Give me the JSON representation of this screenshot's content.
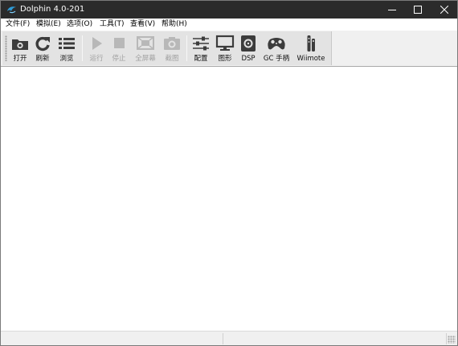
{
  "window": {
    "title": "Dolphin 4.0-201",
    "app_icon": "dolphin-icon",
    "controls": [
      "minimize-icon",
      "maximize-icon",
      "close-icon"
    ]
  },
  "menu": {
    "items": [
      {
        "label": "文件(F)"
      },
      {
        "label": "模拟(E)"
      },
      {
        "label": "选项(O)"
      },
      {
        "label": "工具(T)"
      },
      {
        "label": "查看(V)"
      },
      {
        "label": "帮助(H)"
      }
    ]
  },
  "toolbar": {
    "buttons": [
      {
        "label": "打开",
        "icon": "open-folder-icon",
        "enabled": true
      },
      {
        "label": "刷新",
        "icon": "refresh-icon",
        "enabled": true
      },
      {
        "label": "浏览",
        "icon": "browse-list-icon",
        "enabled": true
      },
      {
        "label": "运行",
        "icon": "play-icon",
        "enabled": false
      },
      {
        "label": "停止",
        "icon": "stop-icon",
        "enabled": false
      },
      {
        "label": "全屏幕",
        "icon": "fullscreen-icon",
        "enabled": false
      },
      {
        "label": "截图",
        "icon": "screenshot-camera-icon",
        "enabled": false
      },
      {
        "label": "配置",
        "icon": "config-sliders-icon",
        "enabled": true
      },
      {
        "label": "图形",
        "icon": "graphics-monitor-icon",
        "enabled": true
      },
      {
        "label": "DSP",
        "icon": "dsp-speaker-icon",
        "enabled": true
      },
      {
        "label": "GC 手柄",
        "icon": "gamecube-controller-icon",
        "enabled": true
      },
      {
        "label": "Wiimote",
        "icon": "wiimote-icon",
        "enabled": true
      }
    ]
  },
  "colors": {
    "titlebar": "#2b2b2b",
    "toolbar": "#e3e3e3",
    "icon_dark": "#3c3c3c",
    "icon_disabled": "#b8b8b8",
    "dolphin_blue": "#2f9bd6"
  },
  "statusbar": {
    "panels": [
      "",
      "",
      ""
    ]
  }
}
